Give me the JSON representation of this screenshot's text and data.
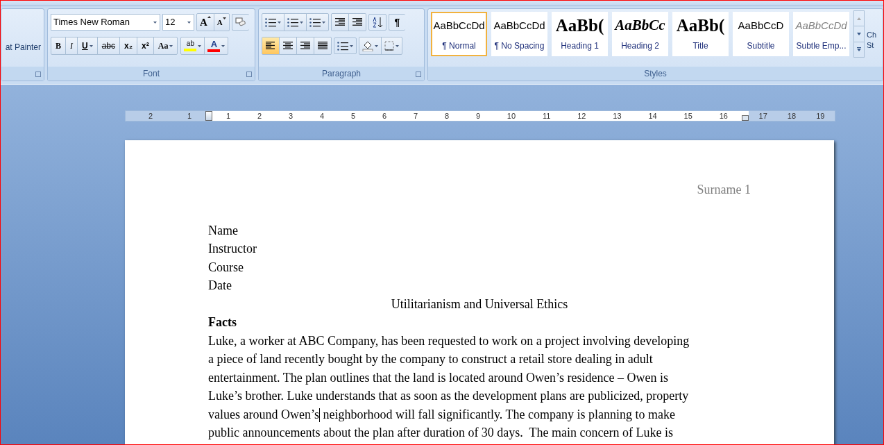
{
  "ribbon": {
    "clipboard": {
      "format_painter": "at Painter"
    },
    "font": {
      "label": "Font",
      "font_name": "Times New Roman",
      "font_size": "12",
      "grow_font": "A",
      "shrink_font": "A",
      "format_buttons": [
        {
          "text": "B",
          "kind": "bold",
          "dropdown": false
        },
        {
          "text": "I",
          "kind": "italic",
          "dropdown": false
        },
        {
          "text": "U",
          "kind": "underline",
          "dropdown": true
        },
        {
          "text": "abc",
          "kind": "strike",
          "dropdown": false
        },
        {
          "text": "x₂",
          "kind": "sub",
          "dropdown": false
        },
        {
          "text": "x²",
          "kind": "sup",
          "dropdown": false
        },
        {
          "text": "Aa",
          "kind": "case",
          "dropdown": true
        }
      ],
      "highlight": {
        "text": "ab",
        "color": "#ffff00"
      },
      "font_color": {
        "text": "A",
        "color": "#ff0000"
      }
    },
    "paragraph": {
      "label": "Paragraph",
      "pilcrow": "¶",
      "alignments": [
        {
          "kind": "left",
          "selected": true
        },
        {
          "kind": "center",
          "selected": false
        },
        {
          "kind": "right",
          "selected": false
        },
        {
          "kind": "justify",
          "selected": false
        }
      ]
    },
    "styles": {
      "label": "Styles",
      "items": [
        {
          "preview": "AaBbCcDd",
          "name": "¶ Normal",
          "kind": "normal",
          "selected": true
        },
        {
          "preview": "AaBbCcDd",
          "name": "¶ No Spacing",
          "kind": "normal",
          "selected": false
        },
        {
          "preview": "AaBb(",
          "name": "Heading 1",
          "kind": "heading",
          "selected": false
        },
        {
          "preview": "AaBbCc",
          "name": "Heading 2",
          "kind": "italic",
          "selected": false
        },
        {
          "preview": "AaBb(",
          "name": "Title",
          "kind": "heading",
          "selected": false
        },
        {
          "preview": "AaBbCcD",
          "name": "Subtitle",
          "kind": "normal",
          "selected": false
        },
        {
          "preview": "AaBbCcDd",
          "name": "Subtle Emp...",
          "kind": "subtle",
          "selected": false
        }
      ],
      "change_styles": [
        "Ch",
        "St"
      ]
    }
  },
  "ruler": {
    "left_labels": [
      "2",
      "1"
    ],
    "labels": [
      "1",
      "2",
      "3",
      "4",
      "5",
      "6",
      "7",
      "8",
      "9",
      "10",
      "11",
      "12",
      "13",
      "14",
      "15",
      "16"
    ],
    "right_labels": [
      "17",
      "18",
      "19"
    ]
  },
  "document": {
    "header": "Surname 1",
    "lines": [
      "Name",
      "Instructor",
      "Course",
      "Date"
    ],
    "title": "Utilitarianism and Universal Ethics",
    "heading": "Facts",
    "paragraph_lines": [
      [
        "Luke, a worker at ABC Company, has been requested to work on a project involving developing"
      ],
      [
        "a piece of land recently bought by the company to construct a retail store dealing in adult"
      ],
      [
        "entertainment. The plan outlines that the land is located around Owen’s residence – Owen is"
      ],
      [
        "Luke’s brother. Luke understands that as soon as the development plans are publicized, property"
      ],
      [
        "values around Owen’s",
        " neighborhood will fall significantly. The company is planning to make"
      ],
      [
        "public announcements about the plan after duration of 30 days.  The main concern of Luke is"
      ]
    ]
  }
}
